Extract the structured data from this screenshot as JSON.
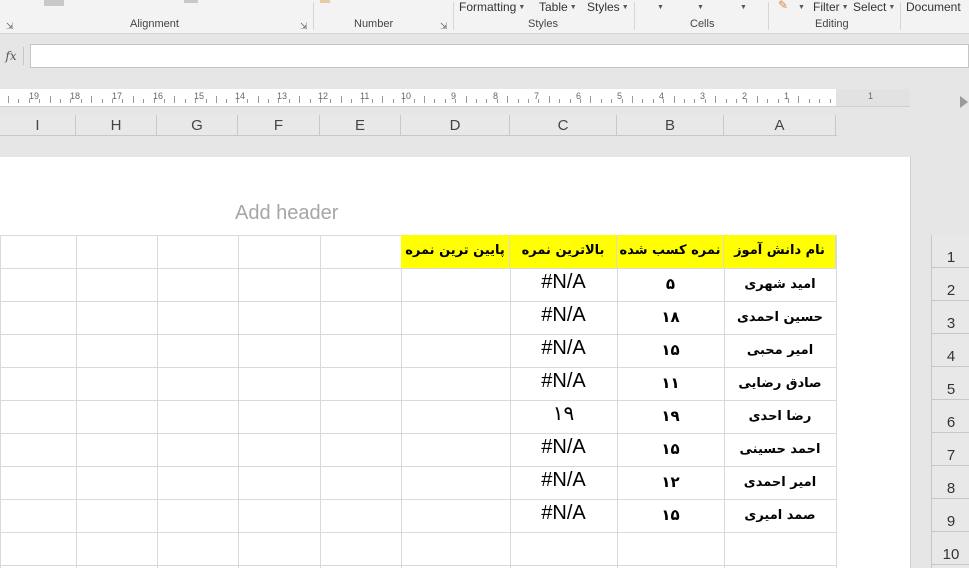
{
  "ribbon": {
    "groups": [
      {
        "label": "Alignment"
      },
      {
        "label": "Number"
      },
      {
        "label": "Styles"
      },
      {
        "label": "Cells"
      },
      {
        "label": "Editing"
      }
    ],
    "buttons": {
      "conditional_formatting": "Formatting",
      "format_as_table": "Table",
      "cell_styles": "Styles",
      "filter": "Filter",
      "select": "Select",
      "document": "Document"
    }
  },
  "formula_bar": {
    "fx_label": "fx",
    "value": ""
  },
  "ruler": {
    "numbers": [
      "19",
      "18",
      "17",
      "16",
      "15",
      "14",
      "13",
      "12",
      "11",
      "10",
      "9",
      "8",
      "7",
      "6",
      "5",
      "4",
      "3",
      "2",
      "1",
      "1"
    ]
  },
  "columns": [
    "I",
    "H",
    "G",
    "F",
    "E",
    "D",
    "C",
    "B",
    "A"
  ],
  "rows": [
    "1",
    "2",
    "3",
    "4",
    "5",
    "6",
    "7",
    "8",
    "9",
    "10"
  ],
  "page": {
    "header_placeholder": "Add header"
  },
  "table": {
    "headers": {
      "name": "نام دانش آموز",
      "score": "نمره کسب شده",
      "max": "بالاترین نمره",
      "min": "پایین ترین نمره"
    },
    "rows": [
      {
        "name": "امید شهری",
        "score": "۵",
        "max": "#N/A"
      },
      {
        "name": "حسین احمدی",
        "score": "۱۸",
        "max": "#N/A"
      },
      {
        "name": "امیر محبی",
        "score": "۱۵",
        "max": "#N/A"
      },
      {
        "name": "صادق رضایی",
        "score": "۱۱",
        "max": "#N/A"
      },
      {
        "name": "رضا احدی",
        "score": "۱۹",
        "max": "۱۹"
      },
      {
        "name": "احمد حسینی",
        "score": "۱۵",
        "max": "#N/A"
      },
      {
        "name": "امیر احمدی",
        "score": "۱۲",
        "max": "#N/A"
      },
      {
        "name": "صمد امیری",
        "score": "۱۵",
        "max": "#N/A"
      }
    ]
  }
}
